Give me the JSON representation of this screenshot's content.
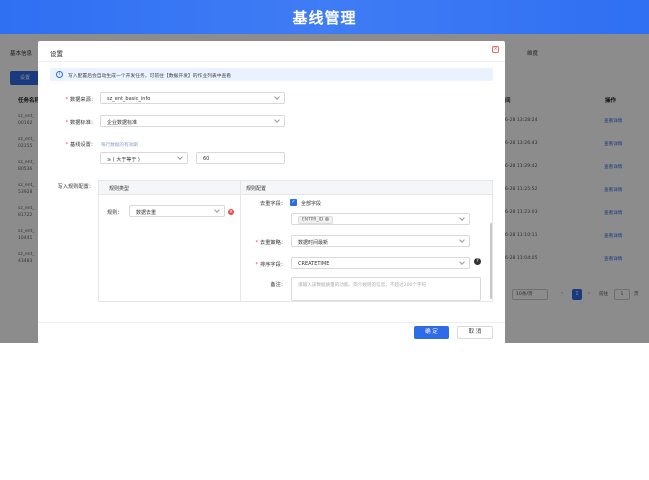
{
  "header": {
    "title": "基线管理"
  },
  "background": {
    "tab_basic": "基本信息",
    "tab_dimension": "维度",
    "settings_button": "设置",
    "col_task_name": "任务名称",
    "col_time": "间",
    "col_action": "操作",
    "rows": [
      {
        "name": "sz_ent_",
        "code": "00102",
        "time": "6-28 13:28:24",
        "action": "查看详情"
      },
      {
        "name": "sz_ent_",
        "code": "02155",
        "time": "6-28 13:26:43",
        "action": "查看详情"
      },
      {
        "name": "sz_ent_",
        "code": "80536",
        "time": "6-28 11:29:42",
        "action": "查看详情"
      },
      {
        "name": "sz_ent_",
        "code": "53928",
        "time": "6-28 11:25:52",
        "action": "查看详情"
      },
      {
        "name": "sz_ent_",
        "code": "81722",
        "time": "6-28 11:23:03",
        "action": "查看详情"
      },
      {
        "name": "sz_ent_",
        "code": "10441",
        "time": "6-28 11:10:11",
        "action": "查看详情"
      },
      {
        "name": "sz_ent_",
        "code": "43483",
        "time": "6-28 11:04:05",
        "action": "查看详情"
      }
    ],
    "pager": {
      "page_size": "10条/页",
      "current_page": "1",
      "goto_label": "前往",
      "goto_value": "1",
      "page_unit": "页"
    }
  },
  "modal": {
    "title": "设置",
    "close_icon": "close-icon",
    "info_text": "写入配置后会自动生成一个开发任务，可前往【数据开发】的作业列表中查看",
    "data_source_label": "数据来源：",
    "data_source_value": "sz_ent_basic_info",
    "data_target_label": "数据标准：",
    "data_target_value": "企业数据标准",
    "baseline_label": "基线设置：",
    "baseline_hint": "每行数据的有效期",
    "baseline_operator": "≥ ( 大于等于 )",
    "baseline_value": "60",
    "write_rule_label": "写入规则配置：",
    "rule_type_header": "规则类型",
    "rule_config_header": "规则配置",
    "rule_label": "规则：",
    "rule_value": "数据去重",
    "dedup_field_label": "去重字段：",
    "all_fields_label": "全部字段",
    "field_tag": "ENTPR_ID",
    "dedup_strategy_label": "去重策略：",
    "dedup_strategy_value": "数据时间最新",
    "sort_field_label": "排序字段：",
    "sort_field_value": "CREATETIME",
    "remark_label": "备注：",
    "remark_placeholder": "请输入该数据质量的功能、简介规则的信息，不超过200个字符",
    "ok_button": "确 定",
    "cancel_button": "取 消"
  }
}
